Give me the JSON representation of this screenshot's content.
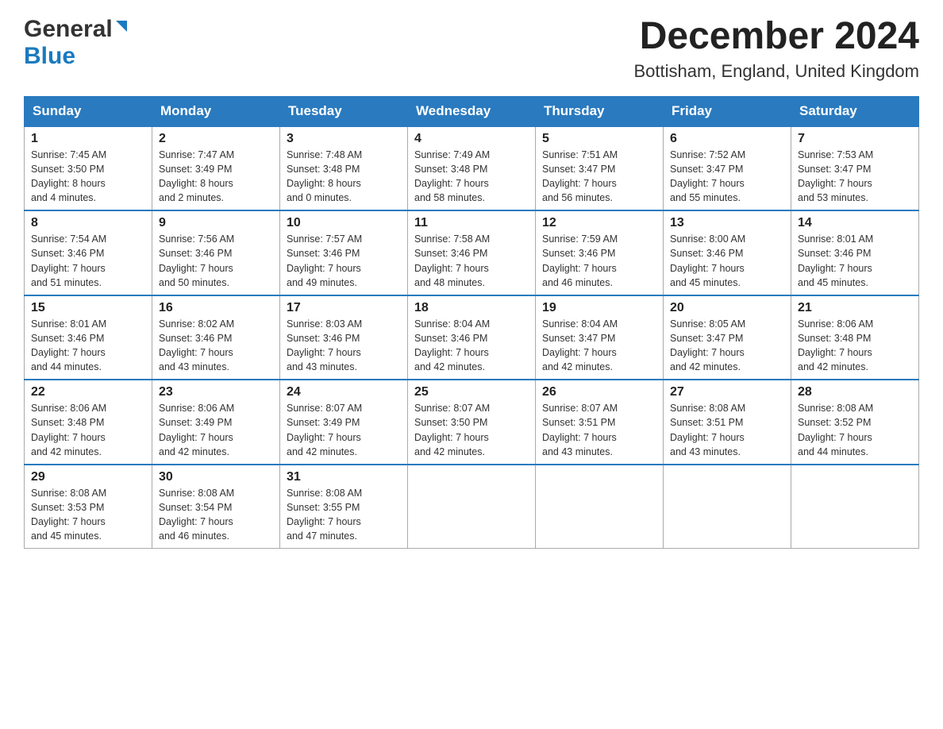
{
  "header": {
    "logo_general": "General",
    "logo_blue": "Blue",
    "month_title": "December 2024",
    "location": "Bottisham, England, United Kingdom"
  },
  "days_of_week": [
    "Sunday",
    "Monday",
    "Tuesday",
    "Wednesday",
    "Thursday",
    "Friday",
    "Saturday"
  ],
  "weeks": [
    [
      {
        "day": "1",
        "sunrise": "Sunrise: 7:45 AM",
        "sunset": "Sunset: 3:50 PM",
        "daylight": "Daylight: 8 hours",
        "daylight2": "and 4 minutes."
      },
      {
        "day": "2",
        "sunrise": "Sunrise: 7:47 AM",
        "sunset": "Sunset: 3:49 PM",
        "daylight": "Daylight: 8 hours",
        "daylight2": "and 2 minutes."
      },
      {
        "day": "3",
        "sunrise": "Sunrise: 7:48 AM",
        "sunset": "Sunset: 3:48 PM",
        "daylight": "Daylight: 8 hours",
        "daylight2": "and 0 minutes."
      },
      {
        "day": "4",
        "sunrise": "Sunrise: 7:49 AM",
        "sunset": "Sunset: 3:48 PM",
        "daylight": "Daylight: 7 hours",
        "daylight2": "and 58 minutes."
      },
      {
        "day": "5",
        "sunrise": "Sunrise: 7:51 AM",
        "sunset": "Sunset: 3:47 PM",
        "daylight": "Daylight: 7 hours",
        "daylight2": "and 56 minutes."
      },
      {
        "day": "6",
        "sunrise": "Sunrise: 7:52 AM",
        "sunset": "Sunset: 3:47 PM",
        "daylight": "Daylight: 7 hours",
        "daylight2": "and 55 minutes."
      },
      {
        "day": "7",
        "sunrise": "Sunrise: 7:53 AM",
        "sunset": "Sunset: 3:47 PM",
        "daylight": "Daylight: 7 hours",
        "daylight2": "and 53 minutes."
      }
    ],
    [
      {
        "day": "8",
        "sunrise": "Sunrise: 7:54 AM",
        "sunset": "Sunset: 3:46 PM",
        "daylight": "Daylight: 7 hours",
        "daylight2": "and 51 minutes."
      },
      {
        "day": "9",
        "sunrise": "Sunrise: 7:56 AM",
        "sunset": "Sunset: 3:46 PM",
        "daylight": "Daylight: 7 hours",
        "daylight2": "and 50 minutes."
      },
      {
        "day": "10",
        "sunrise": "Sunrise: 7:57 AM",
        "sunset": "Sunset: 3:46 PM",
        "daylight": "Daylight: 7 hours",
        "daylight2": "and 49 minutes."
      },
      {
        "day": "11",
        "sunrise": "Sunrise: 7:58 AM",
        "sunset": "Sunset: 3:46 PM",
        "daylight": "Daylight: 7 hours",
        "daylight2": "and 48 minutes."
      },
      {
        "day": "12",
        "sunrise": "Sunrise: 7:59 AM",
        "sunset": "Sunset: 3:46 PM",
        "daylight": "Daylight: 7 hours",
        "daylight2": "and 46 minutes."
      },
      {
        "day": "13",
        "sunrise": "Sunrise: 8:00 AM",
        "sunset": "Sunset: 3:46 PM",
        "daylight": "Daylight: 7 hours",
        "daylight2": "and 45 minutes."
      },
      {
        "day": "14",
        "sunrise": "Sunrise: 8:01 AM",
        "sunset": "Sunset: 3:46 PM",
        "daylight": "Daylight: 7 hours",
        "daylight2": "and 45 minutes."
      }
    ],
    [
      {
        "day": "15",
        "sunrise": "Sunrise: 8:01 AM",
        "sunset": "Sunset: 3:46 PM",
        "daylight": "Daylight: 7 hours",
        "daylight2": "and 44 minutes."
      },
      {
        "day": "16",
        "sunrise": "Sunrise: 8:02 AM",
        "sunset": "Sunset: 3:46 PM",
        "daylight": "Daylight: 7 hours",
        "daylight2": "and 43 minutes."
      },
      {
        "day": "17",
        "sunrise": "Sunrise: 8:03 AM",
        "sunset": "Sunset: 3:46 PM",
        "daylight": "Daylight: 7 hours",
        "daylight2": "and 43 minutes."
      },
      {
        "day": "18",
        "sunrise": "Sunrise: 8:04 AM",
        "sunset": "Sunset: 3:46 PM",
        "daylight": "Daylight: 7 hours",
        "daylight2": "and 42 minutes."
      },
      {
        "day": "19",
        "sunrise": "Sunrise: 8:04 AM",
        "sunset": "Sunset: 3:47 PM",
        "daylight": "Daylight: 7 hours",
        "daylight2": "and 42 minutes."
      },
      {
        "day": "20",
        "sunrise": "Sunrise: 8:05 AM",
        "sunset": "Sunset: 3:47 PM",
        "daylight": "Daylight: 7 hours",
        "daylight2": "and 42 minutes."
      },
      {
        "day": "21",
        "sunrise": "Sunrise: 8:06 AM",
        "sunset": "Sunset: 3:48 PM",
        "daylight": "Daylight: 7 hours",
        "daylight2": "and 42 minutes."
      }
    ],
    [
      {
        "day": "22",
        "sunrise": "Sunrise: 8:06 AM",
        "sunset": "Sunset: 3:48 PM",
        "daylight": "Daylight: 7 hours",
        "daylight2": "and 42 minutes."
      },
      {
        "day": "23",
        "sunrise": "Sunrise: 8:06 AM",
        "sunset": "Sunset: 3:49 PM",
        "daylight": "Daylight: 7 hours",
        "daylight2": "and 42 minutes."
      },
      {
        "day": "24",
        "sunrise": "Sunrise: 8:07 AM",
        "sunset": "Sunset: 3:49 PM",
        "daylight": "Daylight: 7 hours",
        "daylight2": "and 42 minutes."
      },
      {
        "day": "25",
        "sunrise": "Sunrise: 8:07 AM",
        "sunset": "Sunset: 3:50 PM",
        "daylight": "Daylight: 7 hours",
        "daylight2": "and 42 minutes."
      },
      {
        "day": "26",
        "sunrise": "Sunrise: 8:07 AM",
        "sunset": "Sunset: 3:51 PM",
        "daylight": "Daylight: 7 hours",
        "daylight2": "and 43 minutes."
      },
      {
        "day": "27",
        "sunrise": "Sunrise: 8:08 AM",
        "sunset": "Sunset: 3:51 PM",
        "daylight": "Daylight: 7 hours",
        "daylight2": "and 43 minutes."
      },
      {
        "day": "28",
        "sunrise": "Sunrise: 8:08 AM",
        "sunset": "Sunset: 3:52 PM",
        "daylight": "Daylight: 7 hours",
        "daylight2": "and 44 minutes."
      }
    ],
    [
      {
        "day": "29",
        "sunrise": "Sunrise: 8:08 AM",
        "sunset": "Sunset: 3:53 PM",
        "daylight": "Daylight: 7 hours",
        "daylight2": "and 45 minutes."
      },
      {
        "day": "30",
        "sunrise": "Sunrise: 8:08 AM",
        "sunset": "Sunset: 3:54 PM",
        "daylight": "Daylight: 7 hours",
        "daylight2": "and 46 minutes."
      },
      {
        "day": "31",
        "sunrise": "Sunrise: 8:08 AM",
        "sunset": "Sunset: 3:55 PM",
        "daylight": "Daylight: 7 hours",
        "daylight2": "and 47 minutes."
      },
      null,
      null,
      null,
      null
    ]
  ]
}
